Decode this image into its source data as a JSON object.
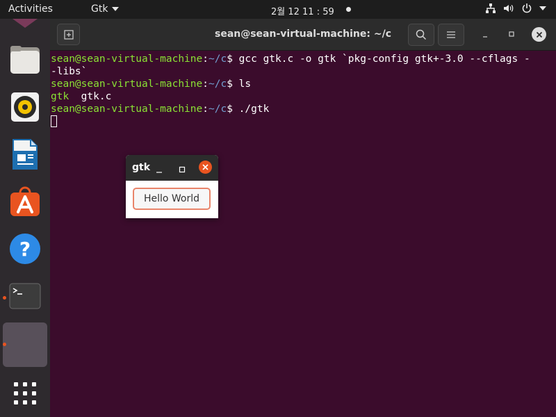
{
  "topbar": {
    "activities": "Activities",
    "app_name": "Gtk",
    "clock": "2월 12  11 : 59"
  },
  "dock": {
    "items": [
      "files-icon",
      "rhythmbox-icon",
      "writer-icon",
      "software-icon",
      "help-icon",
      "terminal-icon",
      "gtk-app-icon",
      "show-apps-icon"
    ]
  },
  "terminal": {
    "title": "sean@sean-virtual-machine: ~/c",
    "prompt_user": "sean@sean-virtual-machine",
    "prompt_colon": ":",
    "prompt_path": "~/c",
    "prompt_symbol": "$ ",
    "cmd1_line1": "gcc gtk.c -o gtk `pkg-config gtk+-3.0 --cflags -",
    "cmd1_line2": "-libs`",
    "cmd2": "ls",
    "ls_out_dir": "gtk",
    "ls_out_sep": "  ",
    "ls_out_file": "gtk.c",
    "cmd3": "./gtk"
  },
  "gtk_window": {
    "title": "gtk",
    "button_label": "Hello World"
  },
  "colors": {
    "terminal_bg": "#3b0c2c",
    "prompt_user": "#8ae234",
    "prompt_path": "#729fcf",
    "accent": "#e95420"
  }
}
